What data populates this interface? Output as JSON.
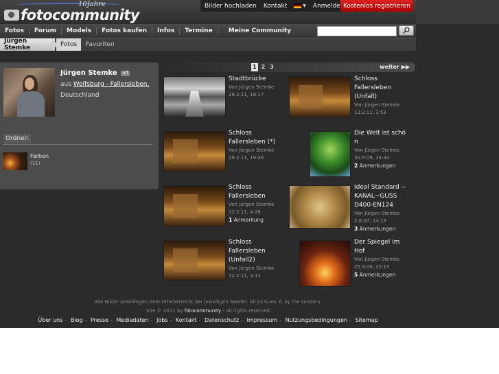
{
  "header": {
    "logo_years": "10Jahre",
    "logo_brand": "fotocommunity",
    "top_links": [
      "Bilder hochladen",
      "Kontakt",
      "Anmelden"
    ],
    "register_label": "Kostenlos registrieren",
    "language_flag": "german-flag-icon"
  },
  "nav": {
    "items": [
      "Fotos",
      "Forum",
      "Models",
      "Fotos kaufen",
      "Infos",
      "Termine"
    ],
    "community": "Meine Community",
    "search_placeholder": ""
  },
  "breadcrumb": {
    "user": "Jürgen Stemke",
    "fotos": "Fotos",
    "favorites": "Favoriten"
  },
  "profile": {
    "name": "Jürgen Stemke",
    "status_badge": "off",
    "from_prefix": "aus",
    "location": "Wolfsburg - Fallersleben,",
    "country": "Deutschland",
    "folder_label": "Ordner:",
    "folder": {
      "name": "Farben",
      "count": "(11)"
    }
  },
  "pager": {
    "pages": [
      "1",
      "2",
      "3"
    ],
    "current": "1",
    "next_label": "weiter"
  },
  "photos": [
    {
      "title": [
        "Stadtbrücke"
      ],
      "author": "Von Jürgen Stemke",
      "date": "28.2.11, 18:17",
      "remarks_count": "",
      "remarks_label": ""
    },
    {
      "title": [
        "Schloss",
        "Fallersleben",
        "(Unfall)"
      ],
      "author": "Von Jürgen Stemke",
      "date": "12.2.11, 3:53",
      "remarks_count": "",
      "remarks_label": ""
    },
    {
      "title": [
        "Schloss",
        "Fallersleben (*)"
      ],
      "author": "Von Jürgen Stemke",
      "date": "19.2.11, 19:46",
      "remarks_count": "",
      "remarks_label": ""
    },
    {
      "title": [
        "Die Welt ist schö",
        "n"
      ],
      "author": "Von Jürgen Stemke",
      "date": "30.5.09, 14:44",
      "remarks_count": "2",
      "remarks_label": "Anmerkungen"
    },
    {
      "title": [
        "Schloss",
        "Fallersleben"
      ],
      "author": "Von Jürgen Stemke",
      "date": "12.2.11, 4:28",
      "remarks_count": "1",
      "remarks_label": "Anmerkung"
    },
    {
      "title": [
        "Ideal Standard --",
        "KANAL~GUSS",
        "D400-EN124"
      ],
      "author": "Von Jürgen Stemke",
      "date": "2.8.07, 14:15",
      "remarks_count": "3",
      "remarks_label": "Anmerkungen"
    },
    {
      "title": [
        "Schloss",
        "Fallersleben",
        "(Unfall2)"
      ],
      "author": "Von Jürgen Stemke",
      "date": "12.2.11, 4:11",
      "remarks_count": "",
      "remarks_label": ""
    },
    {
      "title": [
        "Der Spiegel im",
        "Hof"
      ],
      "author": "Von Jürgen Stemke",
      "date": "25.9.06, 22:15",
      "remarks_count": "5",
      "remarks_label": "Anmerkungen"
    }
  ],
  "footer": {
    "copyright": "Alle Bilder unterliegen dem Urheberrecht der jeweiligen Sender. All pictures © by the senders.",
    "site_prefix": "Site © 2011 by",
    "site_brand": "fotocommunity",
    "site_suffix": "- All rights reserved",
    "links": [
      "Über uns",
      "Blog",
      "Presse",
      "Mediadaten",
      "Jobs",
      "Kontakt",
      "Datenschutz",
      "Impressum",
      "Nutzungsbedingungen",
      "Sitemap"
    ]
  }
}
